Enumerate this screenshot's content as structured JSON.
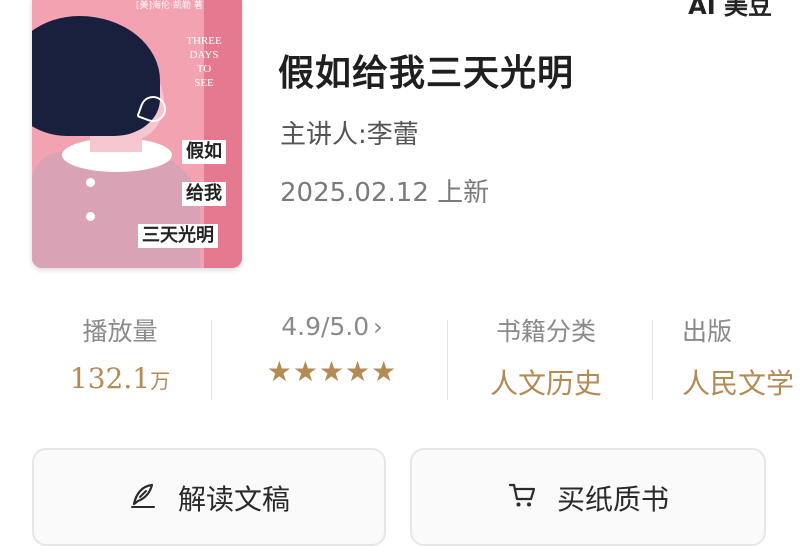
{
  "brand": "AI 美豆",
  "cover": {
    "author": "[美]海伦·凯勒 著",
    "english_title": [
      "THREE",
      "DAYS",
      "TO",
      "SEE"
    ],
    "chinese_lines": [
      "假如",
      "给我",
      "三天光明"
    ]
  },
  "title": "假如给我三天光明",
  "speaker": "主讲人:李蕾",
  "date": "2025.02.12 上新",
  "stats": {
    "plays_label": "播放量",
    "plays_value": "132.1",
    "plays_unit": "万",
    "rating_label": "4.9/5.0",
    "rating_chevron": "›",
    "stars": "★★★★★",
    "rating_value": 4.9,
    "category_label": "书籍分类",
    "category_value": "人文历史",
    "publisher_label": "出版",
    "publisher_value": "人民文学"
  },
  "actions": {
    "read_label": "解读文稿",
    "buy_label": "买纸质书"
  },
  "colors": {
    "accent_gold": "#b48a55",
    "cover_pink": "#f3a2b2"
  },
  "icons": {
    "read": "quill-pen-icon",
    "buy": "shopping-cart-icon"
  }
}
